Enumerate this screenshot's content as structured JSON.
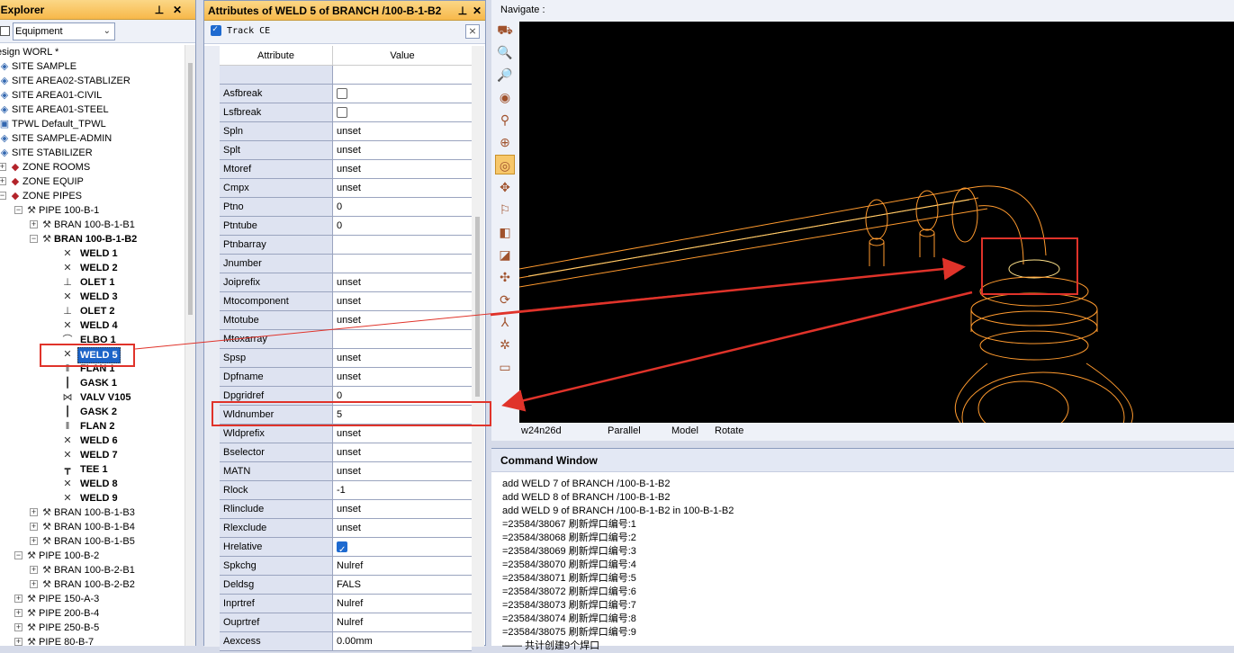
{
  "explorer": {
    "title": "n Explorer",
    "pin_glyph": "📌",
    "close_glyph": "✕",
    "filter_value": "Equipment",
    "tree": [
      {
        "label": "esign WORL *",
        "indent": 0,
        "icon": "",
        "expander": "",
        "bold": false
      },
      {
        "label": "SITE SAMPLE",
        "indent": 0,
        "icon": "site-icon",
        "expander": "",
        "bold": false
      },
      {
        "label": "SITE AREA02-STABLIZER",
        "indent": 0,
        "icon": "site-icon",
        "expander": "",
        "bold": false
      },
      {
        "label": "SITE AREA01-CIVIL",
        "indent": 0,
        "icon": "site-icon",
        "expander": "",
        "bold": false
      },
      {
        "label": "SITE AREA01-STEEL",
        "indent": 0,
        "icon": "site-icon",
        "expander": "",
        "bold": false
      },
      {
        "label": "TPWL Default_TPWL",
        "indent": 0,
        "icon": "tpwl-icon",
        "expander": "",
        "bold": false
      },
      {
        "label": "SITE SAMPLE-ADMIN",
        "indent": 0,
        "icon": "site-icon",
        "expander": "",
        "bold": false
      },
      {
        "label": "SITE STABILIZER",
        "indent": 0,
        "icon": "site-icon",
        "expander": "",
        "bold": false
      },
      {
        "label": "ZONE ROOMS",
        "indent": 1,
        "icon": "zone-icon",
        "expander": "+",
        "bold": false
      },
      {
        "label": "ZONE EQUIP",
        "indent": 1,
        "icon": "zone-icon",
        "expander": "+",
        "bold": false
      },
      {
        "label": "ZONE PIPES",
        "indent": 1,
        "icon": "zone-icon",
        "expander": "−",
        "bold": false
      },
      {
        "label": "PIPE 100-B-1",
        "indent": 2,
        "icon": "pipe-icon",
        "expander": "−",
        "bold": false
      },
      {
        "label": "BRAN 100-B-1-B1",
        "indent": 3,
        "icon": "bran-icon",
        "expander": "+",
        "bold": false
      },
      {
        "label": "BRAN 100-B-1-B2",
        "indent": 3,
        "icon": "bran-icon",
        "expander": "−",
        "bold": true
      },
      {
        "label": "WELD 1",
        "indent": 4,
        "icon": "weld-icon",
        "expander": "",
        "bold": true
      },
      {
        "label": "WELD 2",
        "indent": 4,
        "icon": "weld-icon",
        "expander": "",
        "bold": true
      },
      {
        "label": "OLET 1",
        "indent": 4,
        "icon": "olet-icon",
        "expander": "",
        "bold": true
      },
      {
        "label": "WELD 3",
        "indent": 4,
        "icon": "weld-icon",
        "expander": "",
        "bold": true
      },
      {
        "label": "OLET 2",
        "indent": 4,
        "icon": "olet-icon",
        "expander": "",
        "bold": true
      },
      {
        "label": "WELD 4",
        "indent": 4,
        "icon": "weld-icon",
        "expander": "",
        "bold": true
      },
      {
        "label": "ELBO 1",
        "indent": 4,
        "icon": "elbo-icon",
        "expander": "",
        "bold": true
      },
      {
        "label": "WELD 5",
        "indent": 4,
        "icon": "weld-icon",
        "expander": "",
        "bold": true,
        "selected": true
      },
      {
        "label": "FLAN 1",
        "indent": 4,
        "icon": "flan-icon",
        "expander": "",
        "bold": true
      },
      {
        "label": "GASK 1",
        "indent": 4,
        "icon": "gask-icon",
        "expander": "",
        "bold": true
      },
      {
        "label": "VALV V105",
        "indent": 4,
        "icon": "valv-icon",
        "expander": "",
        "bold": true
      },
      {
        "label": "GASK 2",
        "indent": 4,
        "icon": "gask-icon",
        "expander": "",
        "bold": true
      },
      {
        "label": "FLAN 2",
        "indent": 4,
        "icon": "flan-icon",
        "expander": "",
        "bold": true
      },
      {
        "label": "WELD 6",
        "indent": 4,
        "icon": "weld-icon",
        "expander": "",
        "bold": true
      },
      {
        "label": "WELD 7",
        "indent": 4,
        "icon": "weld-icon",
        "expander": "",
        "bold": true
      },
      {
        "label": "TEE 1",
        "indent": 4,
        "icon": "tee-icon",
        "expander": "",
        "bold": true
      },
      {
        "label": "WELD 8",
        "indent": 4,
        "icon": "weld-icon",
        "expander": "",
        "bold": true
      },
      {
        "label": "WELD 9",
        "indent": 4,
        "icon": "weld-icon",
        "expander": "",
        "bold": true
      },
      {
        "label": "BRAN 100-B-1-B3",
        "indent": 3,
        "icon": "bran-icon",
        "expander": "+",
        "bold": false
      },
      {
        "label": "BRAN 100-B-1-B4",
        "indent": 3,
        "icon": "bran-icon",
        "expander": "+",
        "bold": false
      },
      {
        "label": "BRAN 100-B-1-B5",
        "indent": 3,
        "icon": "bran-icon",
        "expander": "+",
        "bold": false
      },
      {
        "label": "PIPE 100-B-2",
        "indent": 2,
        "icon": "pipe-icon",
        "expander": "−",
        "bold": false
      },
      {
        "label": "BRAN 100-B-2-B1",
        "indent": 3,
        "icon": "bran-icon",
        "expander": "+",
        "bold": false
      },
      {
        "label": "BRAN 100-B-2-B2",
        "indent": 3,
        "icon": "bran-icon",
        "expander": "+",
        "bold": false
      },
      {
        "label": "PIPE 150-A-3",
        "indent": 2,
        "icon": "pipe-icon",
        "expander": "+",
        "bold": false
      },
      {
        "label": "PIPE 200-B-4",
        "indent": 2,
        "icon": "pipe-icon",
        "expander": "+",
        "bold": false
      },
      {
        "label": "PIPE 250-B-5",
        "indent": 2,
        "icon": "pipe-icon",
        "expander": "+",
        "bold": false
      },
      {
        "label": "PIPE 80-B-7",
        "indent": 2,
        "icon": "pipe-icon",
        "expander": "+",
        "bold": false
      }
    ]
  },
  "attributes": {
    "title": "Attributes of WELD 5 of BRANCH /100-B-1-B2",
    "pin_glyph": "📌",
    "close_glyph": "✕",
    "track_ce_label": "Track CE",
    "track_ce_checked": true,
    "col_attribute": "Attribute",
    "col_value": "Value",
    "rows": [
      {
        "attr": "",
        "value": ""
      },
      {
        "attr": "Asfbreak",
        "value": "",
        "type": "checkbox",
        "checked": false
      },
      {
        "attr": "Lsfbreak",
        "value": "",
        "type": "checkbox",
        "checked": false
      },
      {
        "attr": "Spln",
        "value": "unset"
      },
      {
        "attr": "Splt",
        "value": "unset"
      },
      {
        "attr": "Mtoref",
        "value": "unset"
      },
      {
        "attr": "Cmpx",
        "value": "unset"
      },
      {
        "attr": "Ptno",
        "value": "0"
      },
      {
        "attr": "Ptntube",
        "value": "0"
      },
      {
        "attr": "Ptnbarray",
        "value": ""
      },
      {
        "attr": "Jnumber",
        "value": ""
      },
      {
        "attr": "Joiprefix",
        "value": "unset"
      },
      {
        "attr": "Mtocomponent",
        "value": "unset"
      },
      {
        "attr": "Mtotube",
        "value": "unset"
      },
      {
        "attr": "Mtoxarray",
        "value": ""
      },
      {
        "attr": "Spsp",
        "value": "unset"
      },
      {
        "attr": "Dpfname",
        "value": "unset"
      },
      {
        "attr": "Dpgridref",
        "value": "0"
      },
      {
        "attr": "Wldnumber",
        "value": "5"
      },
      {
        "attr": "Wldprefix",
        "value": "unset"
      },
      {
        "attr": "Bselector",
        "value": "unset"
      },
      {
        "attr": "MATN",
        "value": "unset"
      },
      {
        "attr": "Rlock",
        "value": "-1"
      },
      {
        "attr": "Rlinclude",
        "value": "unset"
      },
      {
        "attr": "Rlexclude",
        "value": "unset"
      },
      {
        "attr": "Hrelative",
        "value": "",
        "type": "checkbox",
        "checked": true
      },
      {
        "attr": "Spkchg",
        "value": "Nulref"
      },
      {
        "attr": "Deldsg",
        "value": "FALS"
      },
      {
        "attr": "Inprtref",
        "value": "Nulref"
      },
      {
        "attr": "Ouprtref",
        "value": "Nulref"
      },
      {
        "attr": "Aexcess",
        "value": "0.00mm"
      }
    ]
  },
  "navigate": {
    "label": "Navigate :",
    "tools": [
      "walk-icon",
      "zoom-window-icon",
      "zoom-extents-icon",
      "view-sphere-icon",
      "zoom-in-icon",
      "zoom-icon",
      "rotate-view-icon",
      "pan-icon",
      "measure-icon",
      "shaded-icon",
      "clip-icon",
      "axes-icon",
      "refresh-icon",
      "axis-icon",
      "settings-icon",
      "window-icon"
    ],
    "status": {
      "view_name": "w24n26d",
      "projection": "Parallel",
      "mode": "Model",
      "action": "Rotate"
    }
  },
  "command_window": {
    "title": "Command Window",
    "lines": [
      "add WELD 7 of BRANCH /100-B-1-B2",
      "add WELD 8 of BRANCH /100-B-1-B2",
      "add WELD 9 of BRANCH /100-B-1-B2 in 100-B-1-B2",
      "=23584/38067 刷新焊口编号:1",
      "=23584/38068 刷新焊口编号:2",
      "=23584/38069 刷新焊口编号:3",
      "=23584/38070 刷新焊口编号:4",
      "=23584/38071 刷新焊口编号:5",
      "=23584/38072 刷新焊口编号:6",
      "=23584/38073 刷新焊口编号:7",
      "=23584/38074 刷新焊口编号:8",
      "=23584/38075 刷新焊口编号:9",
      "—— 共计创建9个焊口"
    ]
  },
  "colors": {
    "annotation": "#e0332a",
    "pipe_wire": "#ff9a2e",
    "selection": "#1c64c8",
    "header_orange": "#f7b84a"
  }
}
